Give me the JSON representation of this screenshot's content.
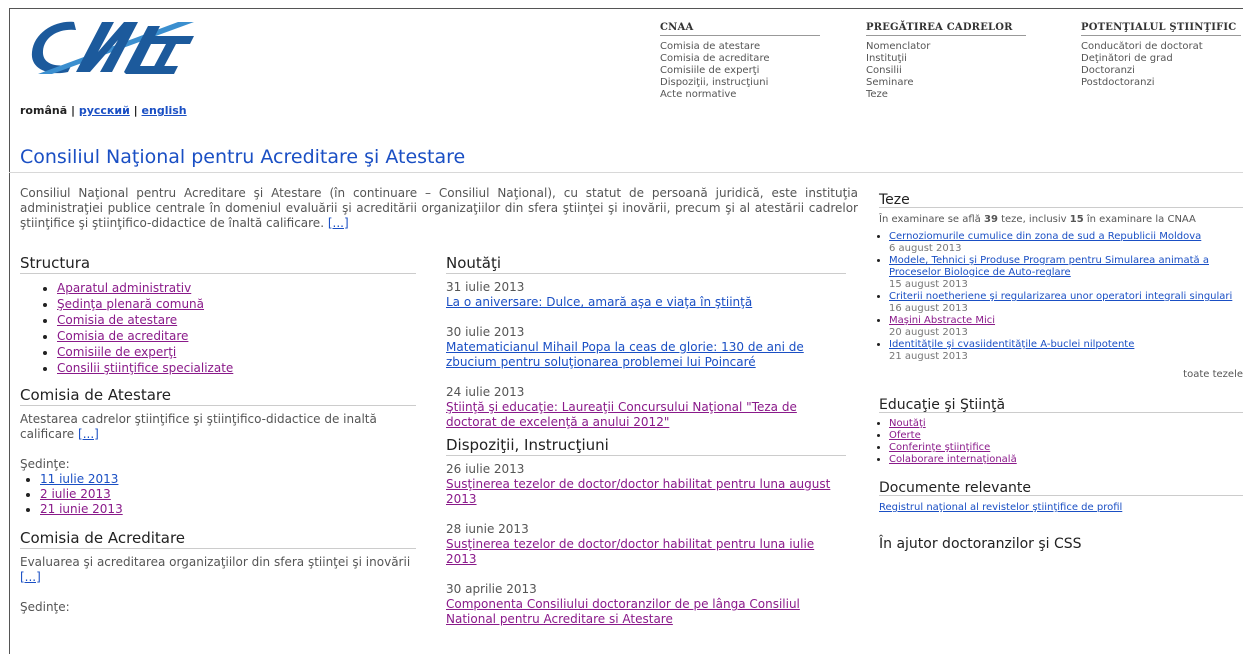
{
  "header": {
    "logo_text": "CNAA",
    "lang_ro": "română",
    "lang_sep1": "|",
    "lang_ru": "русский",
    "lang_sep2": "|",
    "lang_en": "english"
  },
  "topnav": [
    {
      "heading": "CNAA",
      "items": [
        "Comisia de atestare",
        "Comisia de acreditare",
        "Comisiile de experţi",
        "Dispoziţii, instrucţiuni",
        "Acte normative"
      ]
    },
    {
      "heading": "PREGĂTIREA CADRELOR",
      "items": [
        "Nomenclator",
        "Instituţii",
        "Consilii",
        "Seminare",
        "Teze"
      ]
    },
    {
      "heading": "POTENŢIALUL ŞTIINŢIFIC",
      "items": [
        "Conducători de doctorat",
        "Deţinători de grad",
        "Doctoranzi",
        "Postdoctoranzi"
      ]
    }
  ],
  "page_title": "Consiliul Naţional pentru Acreditare şi Atestare",
  "intro": {
    "text": "Consiliul Naţional pentru Acreditare şi Atestare (în continuare – Consiliul Naţional), cu statut de persoană juridică, este instituţia administraţiei publice centrale în domeniul evaluării şi acreditării organizaţiilor din sfera ştiinţei şi inovării, precum şi al atestării cadrelor ştiinţifice şi ştiinţifico-didactice de înaltă calificare.",
    "more": "[...]"
  },
  "structura": {
    "heading": "Structura",
    "items": [
      "Aparatul administrativ",
      "Şedinţa plenară comună",
      "Comisia de atestare",
      "Comisia de acreditare",
      "Comisiile de experţi",
      "Consilii ştiinţifice specializate"
    ]
  },
  "atestare": {
    "heading": "Comisia de Atestare",
    "text": "Atestarea cadrelor ştiinţifice şi ştiinţifico-didactice de inaltă calificare",
    "more": "[...]",
    "sedinte_label": "Şedinţe:",
    "sedinte": [
      "11 iulie 2013",
      "2 iulie 2013",
      "21 iunie 2013"
    ]
  },
  "acreditare": {
    "heading": "Comisia de Acreditare",
    "text": "Evaluarea şi acreditarea organizaţiilor din sfera ştiinţei şi inovării",
    "more": "[...]",
    "sedinte_label": "Şedinţe:"
  },
  "noutati": {
    "heading": "Noutăţi",
    "items": [
      {
        "date": "31 iulie 2013",
        "title": "La o aniversare: Dulce, amară aşa e viaţa în ştiinţă"
      },
      {
        "date": "30 iulie 2013",
        "title": "Matematicianul Mihail Popa la ceas de glorie: 130 de ani de zbucium pentru soluţionarea problemei lui Poincaré"
      },
      {
        "date": "24 iulie 2013",
        "title": "Ştiinţă şi educaţie: Laureaţii Concursului Naţional \"Teza de doctorat de excelenţă a anului 2012\""
      }
    ]
  },
  "dispozitii": {
    "heading": "Dispoziţii, Instrucţiuni",
    "items": [
      {
        "date": "26 iulie 2013",
        "title": "Susţinerea tezelor de doctor/doctor habilitat pentru luna august 2013"
      },
      {
        "date": "28 iunie 2013",
        "title": "Susţinerea tezelor de doctor/doctor habilitat pentru luna iulie 2013"
      },
      {
        "date": "30 aprilie 2013",
        "title": "Componenta Consiliului doctoranzilor de pe lânga Consiliul National pentru Acreditare si Atestare"
      }
    ]
  },
  "teze": {
    "heading": "Teze",
    "summary_pre": "În examinare se află",
    "count": "39",
    "summary_mid": "teze, inclusiv",
    "count_cnaa": "15",
    "summary_post": "în examinare la CNAA",
    "items": [
      {
        "title": "Cernoziomurile cumulice din zona de sud a Republicii Moldova",
        "date": "6 august 2013"
      },
      {
        "title": "Modele, Tehnici şi Produse Program pentru Simularea animată a Proceselor Biologice de Auto-reglare",
        "date": "15 august 2013"
      },
      {
        "title": "Criterii noetheriene şi regularizarea unor operatori integrali singulari",
        "date": "16 august 2013"
      },
      {
        "title": "Maşini Abstracte Mici",
        "date": "20 august 2013"
      },
      {
        "title": "Identităţile şi cvasiidentităţile A-buclei nilpotente",
        "date": "21 august 2013"
      }
    ],
    "all_link": "toate tezele"
  },
  "educatie": {
    "heading": "Educaţie şi Ştiinţă",
    "items": [
      "Noutăţi",
      "Oferte",
      "Conferinţe ştiinţifice",
      "Colaborare internaţională"
    ]
  },
  "documente": {
    "heading": "Documente relevante",
    "link": "Registrul naţional al revistelor ştiinţifice de profil"
  },
  "ajutor": {
    "heading": "În ajutor doctoranzilor şi CSS"
  }
}
